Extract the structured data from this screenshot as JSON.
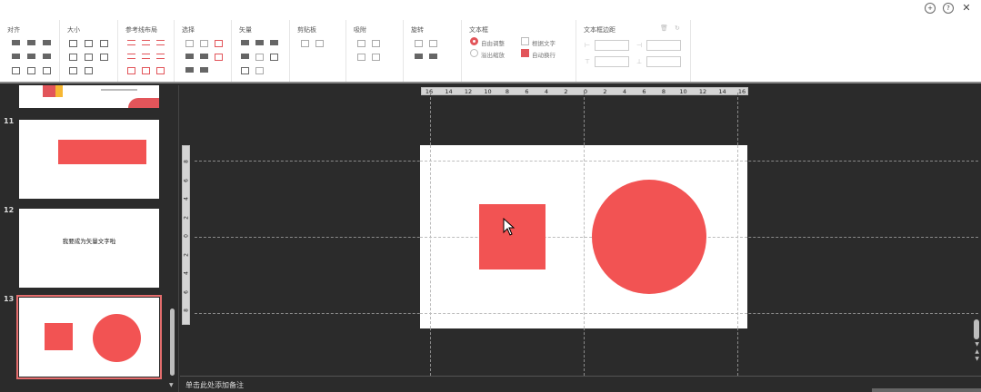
{
  "ribbon": {
    "groups": {
      "align": "对齐",
      "size": "大小",
      "guides": "参考线布局",
      "select": "选择",
      "vector": "矢量",
      "clipboard": "剪贴板",
      "snap": "吸附",
      "rotate": "旋转",
      "textbox": "文本框",
      "textbox_margin": "文本框边距"
    },
    "textbox_options": {
      "auto_adjust": "自由调整",
      "overflow_shrink": "溢出缩放",
      "shape_by_text": "根据文字",
      "auto_wrap": "自动换行"
    },
    "top_icons": [
      "plus-circle-icon",
      "help-icon",
      "close-icon"
    ]
  },
  "slides": [
    {
      "number": "11"
    },
    {
      "number": "12",
      "text": "我要成为矢量文字啦"
    },
    {
      "number": "13"
    }
  ],
  "ruler": {
    "h_labels": [
      "16",
      "14",
      "12",
      "10",
      "8",
      "6",
      "4",
      "2",
      "0",
      "2",
      "4",
      "6",
      "8",
      "10",
      "12",
      "14",
      "16"
    ],
    "v_labels": [
      "8",
      "6",
      "4",
      "2",
      "0",
      "2",
      "4",
      "6",
      "8"
    ]
  },
  "notes": {
    "placeholder": "单击此处添加备注"
  },
  "colors": {
    "accent": "#f25353",
    "background": "#2b2b2b"
  }
}
